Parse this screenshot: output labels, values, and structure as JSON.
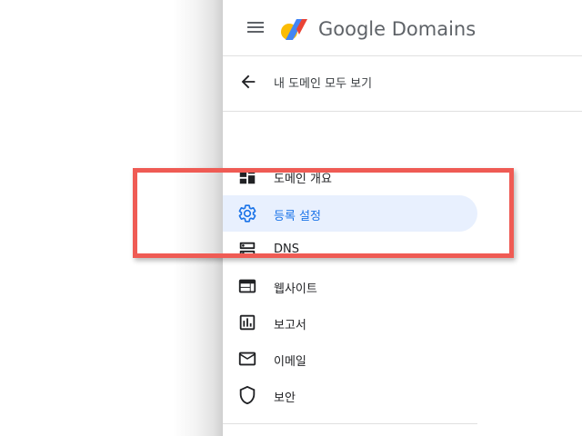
{
  "header": {
    "brand": "Google Domains",
    "menu_icon": "hamburger-menu-icon",
    "logo_colors": {
      "yellow": "#fbbc04",
      "blue": "#4285f4",
      "red": "#ea4335"
    }
  },
  "back_link": {
    "label": "내 도메인 모두 보기",
    "icon": "arrow-back-icon"
  },
  "nav": {
    "items": [
      {
        "label": "도메인 개요",
        "icon": "dashboard-icon",
        "active": false
      },
      {
        "label": "등록 설정",
        "icon": "gear-icon",
        "active": true
      },
      {
        "label": "DNS",
        "icon": "dns-icon",
        "active": false
      },
      {
        "label": "웹사이트",
        "icon": "web-icon",
        "active": false
      },
      {
        "label": "보고서",
        "icon": "bar-chart-icon",
        "active": false
      },
      {
        "label": "이메일",
        "icon": "mail-icon",
        "active": false
      },
      {
        "label": "보안",
        "icon": "shield-icon",
        "active": false
      }
    ]
  },
  "annotation": {
    "color": "#ef5b54"
  },
  "colors": {
    "active_bg": "#e8f0fe",
    "active_fg": "#1a73e8",
    "icon": "#202124",
    "text_muted": "#5f6368"
  }
}
